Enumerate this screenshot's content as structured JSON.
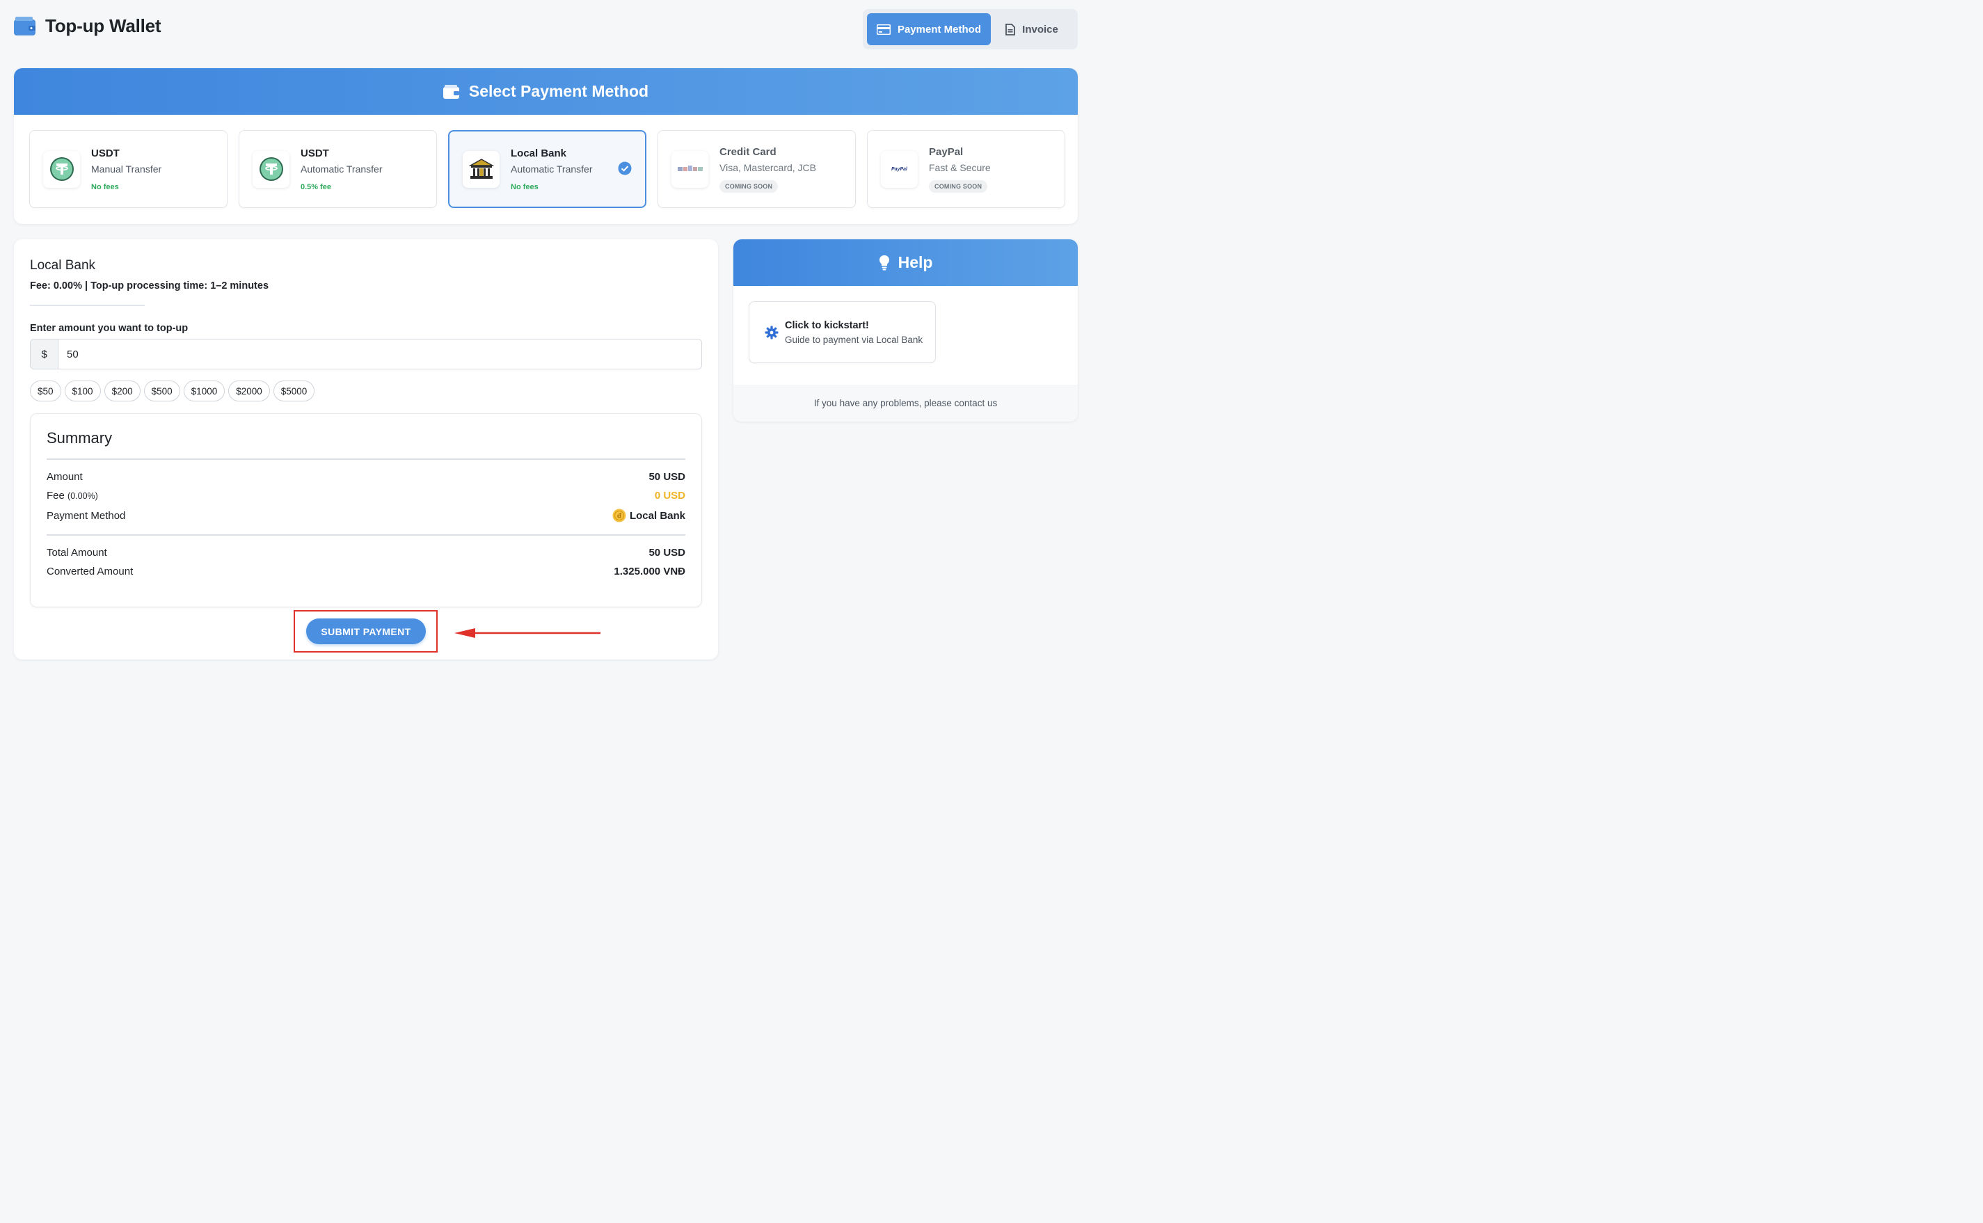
{
  "header": {
    "title": "Top-up Wallet",
    "icon": "wallet-icon",
    "tabs": [
      {
        "label": "Payment Method",
        "icon": "credit-card-icon",
        "active": true
      },
      {
        "label": "Invoice",
        "icon": "document-icon",
        "active": false
      }
    ]
  },
  "select_payment": {
    "title": "Select Payment Method",
    "icon": "wallet-icon",
    "methods": [
      {
        "name": "USDT",
        "subtitle": "Manual Transfer",
        "fee": "No fees",
        "logo": "tether-logo",
        "status": "available"
      },
      {
        "name": "USDT",
        "subtitle": "Automatic Transfer",
        "fee": "0.5% fee",
        "logo": "tether-logo",
        "status": "available"
      },
      {
        "name": "Local Bank",
        "subtitle": "Automatic Transfer",
        "fee": "No fees",
        "logo": "bank-building-logo",
        "status": "selected"
      },
      {
        "name": "Credit Card",
        "subtitle": "Visa, Mastercard, JCB",
        "badge": "COMING SOON",
        "logo": "card-brands-logo",
        "status": "disabled"
      },
      {
        "name": "PayPal",
        "subtitle": "Fast & Secure",
        "badge": "COMING SOON",
        "logo": "paypal-logo",
        "logo_text": "PayPal",
        "status": "disabled"
      }
    ]
  },
  "form": {
    "title": "Local Bank",
    "meta": "Fee: 0.00% | Top-up processing time: 1–2 minutes",
    "amount_label": "Enter amount you want to top-up",
    "currency_symbol": "$",
    "amount_value": "50",
    "quick_amounts": [
      "$50",
      "$100",
      "$200",
      "$500",
      "$1000",
      "$2000",
      "$5000"
    ]
  },
  "summary": {
    "title": "Summary",
    "amount_label": "Amount",
    "amount_value": "50 USD",
    "fee_label": "Fee",
    "fee_rate": "(0.00%)",
    "fee_value": "0 USD",
    "method_label": "Payment Method",
    "method_value": "Local Bank",
    "total_label": "Total Amount",
    "total_value": "50 USD",
    "converted_label": "Converted Amount",
    "converted_value": "1.325.000 VNĐ"
  },
  "submit_label": "SUBMIT PAYMENT",
  "help": {
    "title": "Help",
    "icon": "lightbulb-icon",
    "guide_title": "Click to kickstart!",
    "guide_subtitle": "Guide to payment via Local Bank",
    "footer": "If you have any problems, please contact us"
  },
  "colors": {
    "primary": "#4a8fe0",
    "success": "#2eaa5c",
    "fee_highlight": "#f0b429",
    "annotation": "#e0302a"
  }
}
